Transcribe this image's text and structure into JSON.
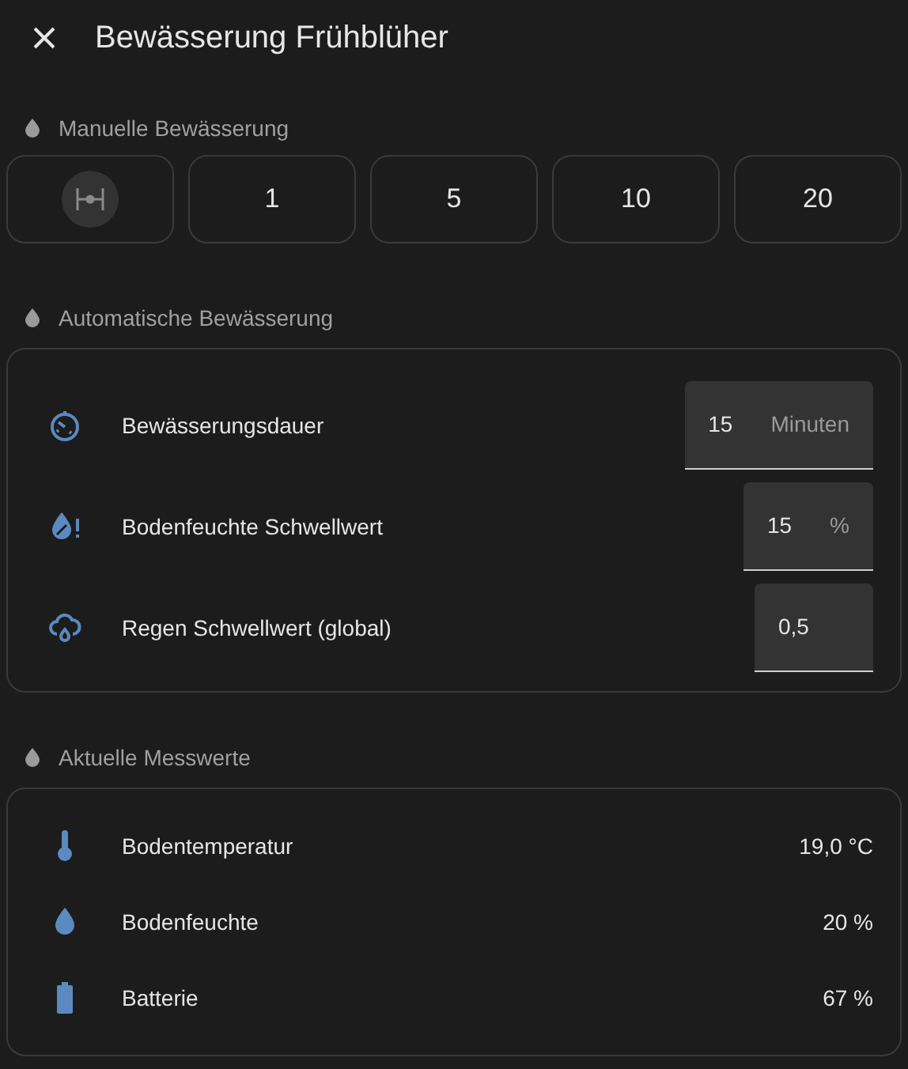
{
  "dialog": {
    "title": "Bewässerung Frühblüher"
  },
  "manual": {
    "title": "Manuelle Bewässerung",
    "buttons": [
      {
        "kind": "icon"
      },
      {
        "kind": "text",
        "label": "1"
      },
      {
        "kind": "text",
        "label": "5"
      },
      {
        "kind": "text",
        "label": "10"
      },
      {
        "kind": "text",
        "label": "20"
      }
    ]
  },
  "automatic": {
    "title": "Automatische Bewässerung",
    "rows": [
      {
        "kind": "timer",
        "label": "Bewässerungsdauer",
        "value": "15",
        "unit": "Minuten"
      },
      {
        "kind": "moisture",
        "label": "Bodenfeuchte Schwellwert",
        "value": "15",
        "unit": "%"
      },
      {
        "kind": "rain",
        "label": "Regen Schwellwert (global)",
        "value": "0,5"
      }
    ]
  },
  "readings": {
    "title": "Aktuelle Messwerte",
    "rows": [
      {
        "kind": "temperature",
        "label": "Bodentemperatur",
        "value": "19,0 °C"
      },
      {
        "kind": "drop",
        "label": "Bodenfeuchte",
        "value": "20 %"
      },
      {
        "kind": "battery",
        "label": "Batterie",
        "value": "67 %"
      }
    ]
  }
}
